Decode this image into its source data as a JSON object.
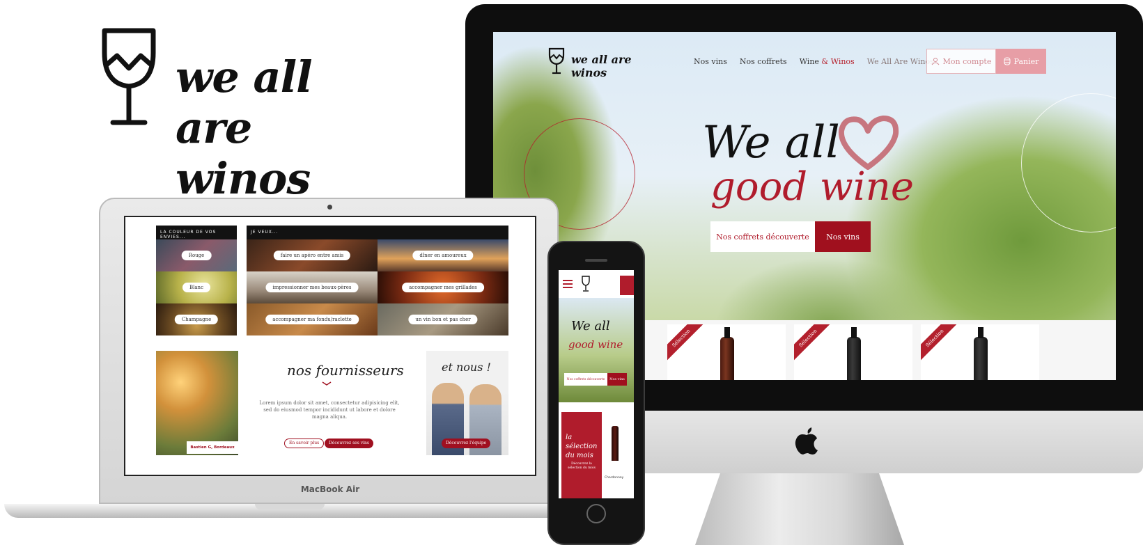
{
  "brand": {
    "wordmark": "we all are winos",
    "accent_color": "#b01c2c",
    "accent_light": "#e79ea6"
  },
  "imac": {
    "site": {
      "logo_text": "we all are winos",
      "nav": {
        "item1": "Nos vins",
        "item2": "Nos coffrets",
        "item3_a": "Wine",
        "item3_amp": "&",
        "item3_b": "Winos",
        "item4": "We All Are Winos"
      },
      "account_label": "Mon compte",
      "cart_label": "Panier",
      "hero_line1": "We all",
      "hero_line2": "good wine",
      "hero_btn_discover": "Nos coffrets découverte",
      "hero_btn_wines": "Nos vins",
      "product_ribbons": [
        "Sélection",
        "Sélection",
        "Sélection"
      ]
    }
  },
  "macbook": {
    "label": "MacBook Air",
    "col1_head": "LA COULEUR DE VOS ENVIES...",
    "col2_head": "JE VEUX...",
    "colors": [
      "Rouge",
      "Blanc",
      "Champagne"
    ],
    "wants": [
      "faire un apéro entre amis",
      "dîner en amoureux",
      "impressionner mes beaux-pères",
      "accompagner mes grillades",
      "accompagner ma fondu/raclette",
      "un vin bon et pas cher"
    ],
    "suppliers": {
      "title": "nos fournisseurs",
      "text": "Lorem ipsum dolor sit amet, consectetur adipisicing elit, sed do eiusmod tempor incididunt ut labore et dolore magna aliqua.",
      "btn_more": "En savoir plus",
      "btn_discover": "Découvrez ses vins",
      "caption": "Bastien G, Bordeaux"
    },
    "team": {
      "title": "et nous !",
      "btn": "Découvrez l'équipe"
    }
  },
  "iphone": {
    "hero_line1": "We all",
    "hero_line2": "good wine",
    "btn_discover": "Nos coffrets découverte",
    "btn_wines": "Nos vins",
    "selection_title": "la sélection du mois",
    "selection_text": "Découvrez la sélection du mois",
    "product_badge": "Chardonnay"
  }
}
